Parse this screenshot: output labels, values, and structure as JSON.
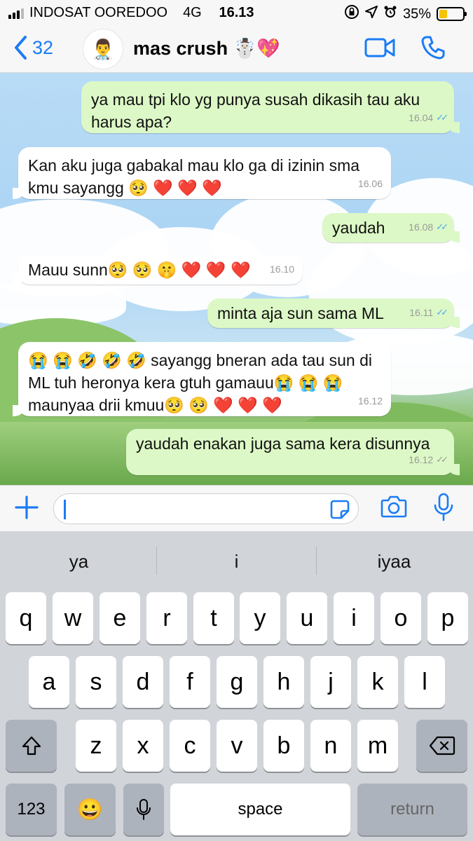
{
  "status_bar": {
    "carrier": "INDOSAT OOREDOO",
    "network": "4G",
    "time": "16.13",
    "battery_text": "35%",
    "battery_level": 0.35
  },
  "header": {
    "back_count": "32",
    "contact_name": "mas crush ☃️💖",
    "avatar_emoji": "👨‍⚕️"
  },
  "messages": [
    {
      "direction": "out",
      "text": "ya mau tpi klo yg punya susah dikasih tau aku harus apa?",
      "time": "16.04",
      "ticks": "✓✓",
      "read": true
    },
    {
      "direction": "in",
      "text": "Kan aku juga gabakal mau klo ga di izinin sma kmu sayangg 🥺 ❤️ ❤️ ❤️",
      "time": "16.06"
    },
    {
      "direction": "out",
      "text": "yaudah",
      "time": "16.08",
      "ticks": "✓✓",
      "read": true
    },
    {
      "direction": "in",
      "text": "Mauu sunn🥺 🥺 🤫 ❤️ ❤️ ❤️",
      "time": "16.10"
    },
    {
      "direction": "out",
      "text": "minta aja sun sama ML",
      "time": "16.11",
      "ticks": "✓✓",
      "read": true
    },
    {
      "direction": "in",
      "text": "😭 😭 🤣 🤣 🤣  sayangg bneran ada tau sun di ML tuh heronya kera gtuh gamauu😭 😭 😭 maunyaa drii kmuu🥺 🥺 ❤️ ❤️ ❤️",
      "time": "16.12"
    },
    {
      "direction": "out",
      "text": "yaudah enakan juga sama kera disunnya",
      "time": "16.12",
      "ticks": "✓✓",
      "read": false
    }
  ],
  "input": {
    "placeholder": ""
  },
  "keyboard": {
    "suggestions": [
      "ya",
      "i",
      "iyaa"
    ],
    "row1": [
      "q",
      "w",
      "e",
      "r",
      "t",
      "y",
      "u",
      "i",
      "o",
      "p"
    ],
    "row2": [
      "a",
      "s",
      "d",
      "f",
      "g",
      "h",
      "j",
      "k",
      "l"
    ],
    "row3": [
      "z",
      "x",
      "c",
      "v",
      "b",
      "n",
      "m"
    ],
    "numbers_key": "123",
    "emoji_key": "😀",
    "space_key": "space",
    "return_key": "return"
  },
  "colors": {
    "accent": "#1a7cf5",
    "outgoing_bubble": "#dcf8c6",
    "incoming_bubble": "#ffffff",
    "read_ticks": "#4fa9e8"
  }
}
